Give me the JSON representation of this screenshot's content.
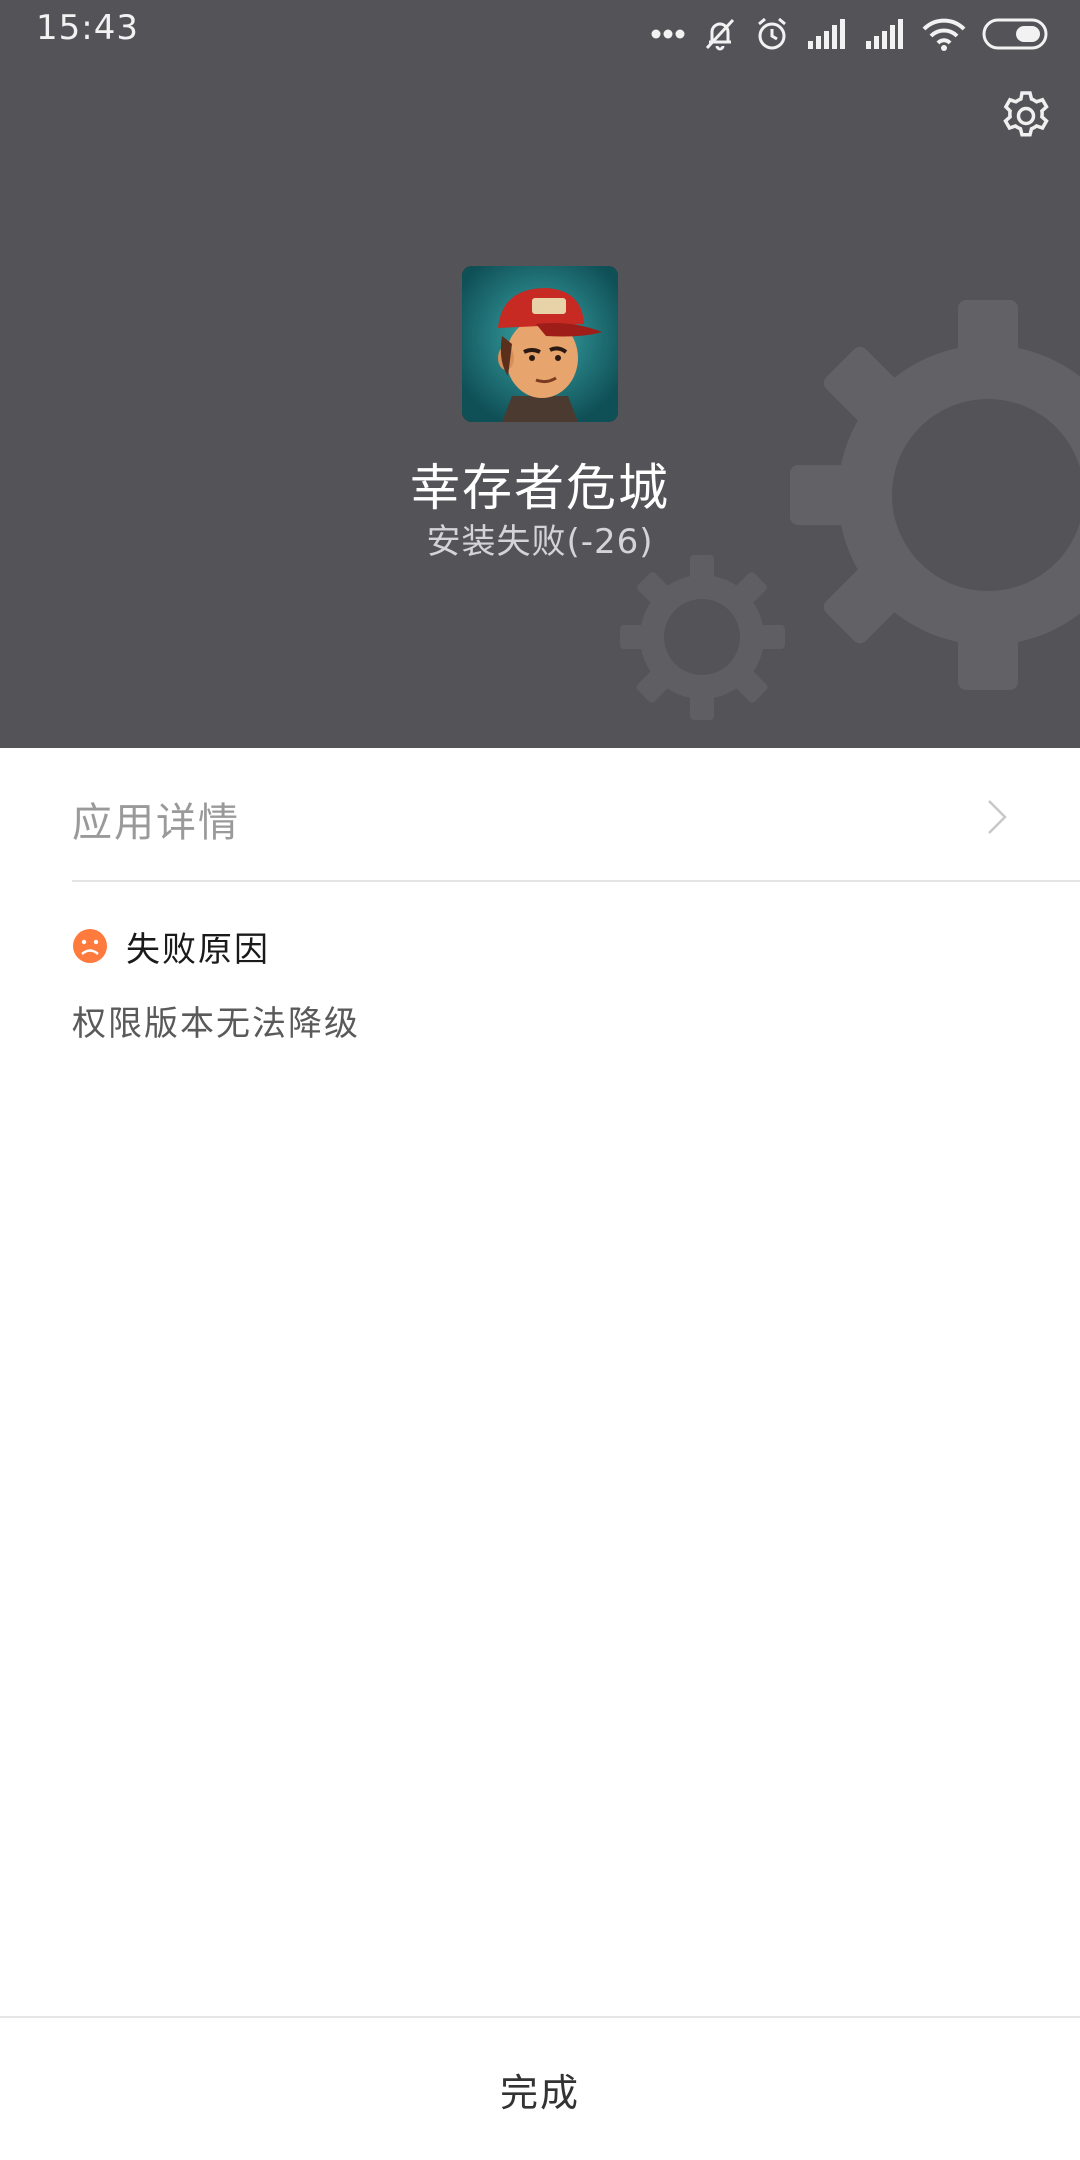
{
  "status_bar": {
    "time": "15:43",
    "icons": [
      "more-dots-icon",
      "mute-bell-icon",
      "alarm-icon",
      "signal-icon",
      "signal-icon",
      "wifi-icon",
      "battery-icon"
    ]
  },
  "header": {
    "background": "#545358",
    "settings_icon": "gear-icon",
    "app_name": "幸存者危城",
    "install_status": "安装失败(-26)"
  },
  "details": {
    "label": "应用详情",
    "chevron_icon": "chevron-right-icon"
  },
  "failure": {
    "icon": "sad-face-icon",
    "icon_color": "#ff7a3d",
    "title": "失败原因",
    "reason": "权限版本无法降级"
  },
  "footer": {
    "done_label": "完成"
  }
}
